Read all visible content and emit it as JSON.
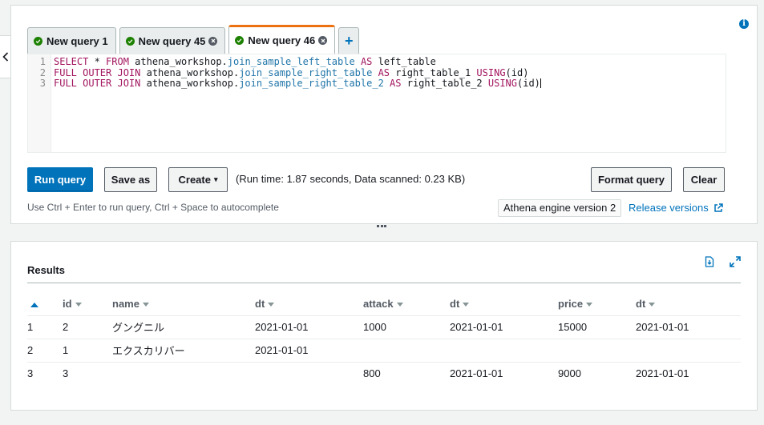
{
  "tabs": [
    {
      "label": "New query 1",
      "closable": false,
      "active": false
    },
    {
      "label": "New query 45",
      "closable": true,
      "active": false
    },
    {
      "label": "New query 46",
      "closable": true,
      "active": true
    }
  ],
  "add_tab_label": "+",
  "editor": {
    "line_numbers": [
      "1",
      "2",
      "3"
    ],
    "lines": [
      [
        {
          "t": "SELECT * FROM ",
          "c": "kw-partial"
        },
        {
          "t": "athena_workshop.",
          "c": ""
        },
        {
          "t": "join_sample_left_table",
          "c": "tbl"
        },
        {
          "t": " AS ",
          "c": "kw"
        },
        {
          "t": "left_table",
          "c": ""
        }
      ],
      [
        {
          "t": "FULL OUTER JOIN ",
          "c": "kw"
        },
        {
          "t": "athena_workshop.",
          "c": ""
        },
        {
          "t": "join_sample_right_table",
          "c": "tbl"
        },
        {
          "t": " AS ",
          "c": "kw"
        },
        {
          "t": "right_table_1 ",
          "c": ""
        },
        {
          "t": "USING",
          "c": "kw"
        },
        {
          "t": "(id)",
          "c": ""
        }
      ],
      [
        {
          "t": "FULL OUTER JOIN ",
          "c": "kw"
        },
        {
          "t": "athena_workshop.",
          "c": ""
        },
        {
          "t": "join_sample_right_table_2",
          "c": "tbl"
        },
        {
          "t": " AS ",
          "c": "kw"
        },
        {
          "t": "right_table_2 ",
          "c": ""
        },
        {
          "t": "USING",
          "c": "kw"
        },
        {
          "t": "(id)",
          "c": ""
        }
      ]
    ]
  },
  "toolbar": {
    "run_label": "Run query",
    "save_as_label": "Save as",
    "create_label": "Create",
    "run_info": "(Run time: 1.87 seconds, Data scanned: 0.23 KB)",
    "format_label": "Format query",
    "clear_label": "Clear"
  },
  "hint": "Use Ctrl + Enter to run query, Ctrl + Space to autocomplete",
  "engine_badge": "Athena engine version 2",
  "release_link": "Release versions",
  "results": {
    "title": "Results",
    "columns": [
      "id",
      "name",
      "dt",
      "attack",
      "dt",
      "price",
      "dt"
    ],
    "rows": [
      {
        "n": "1",
        "cells": [
          "2",
          "グングニル",
          "2021-01-01",
          "1000",
          "2021-01-01",
          "15000",
          "2021-01-01"
        ]
      },
      {
        "n": "2",
        "cells": [
          "1",
          "エクスカリバー",
          "2021-01-01",
          "",
          "",
          "",
          ""
        ]
      },
      {
        "n": "3",
        "cells": [
          "3",
          "",
          "",
          "800",
          "2021-01-01",
          "9000",
          "2021-01-01"
        ]
      }
    ]
  },
  "colors": {
    "accent": "#0073bb",
    "tab_active": "#ec7211",
    "success": "#1d8102",
    "keyword": "#a2165f",
    "table_ref": "#2075a8"
  },
  "icons": [
    "chevron-left-icon",
    "info-icon",
    "check-circle-icon",
    "close-circle-icon",
    "plus-icon",
    "external-link-icon",
    "download-icon",
    "expand-icon",
    "sort-ascending-icon",
    "sort-caret-icon"
  ]
}
